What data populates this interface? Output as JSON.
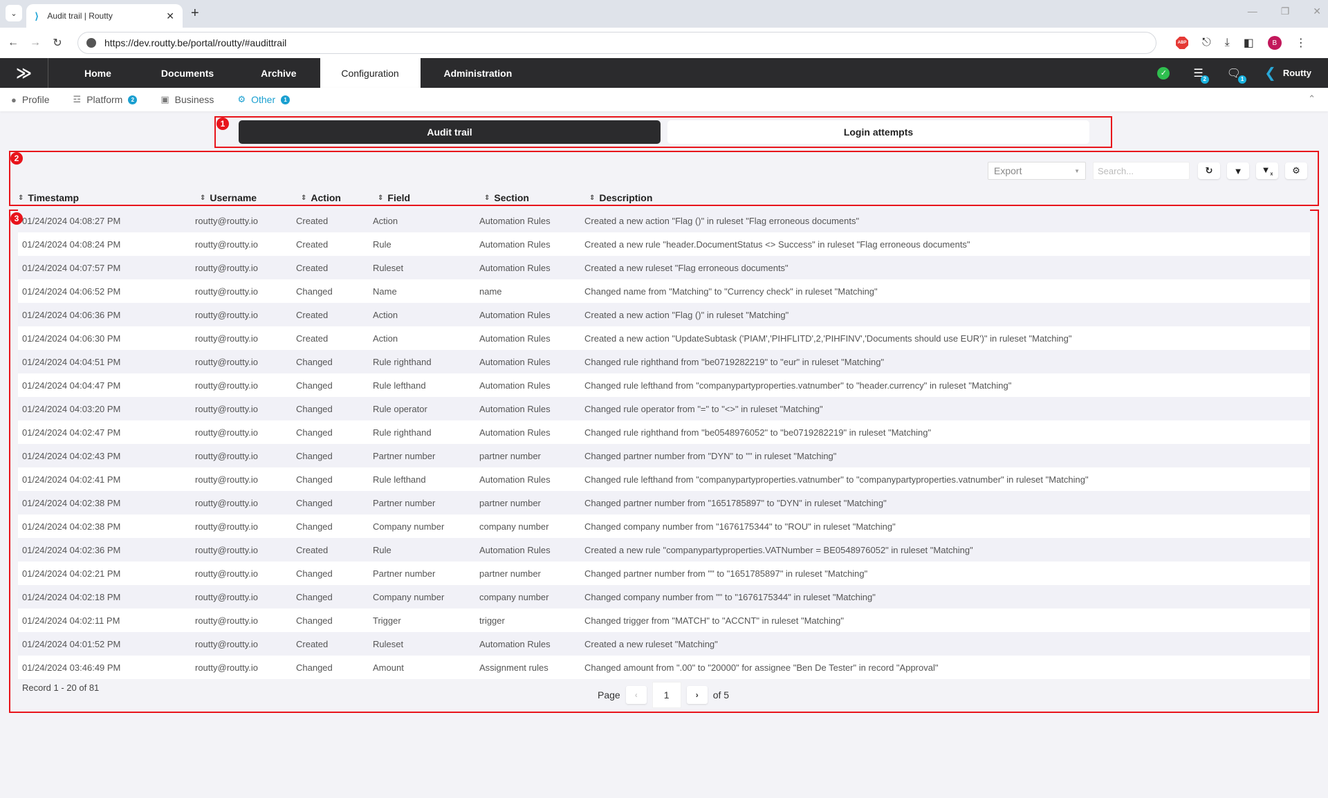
{
  "browser": {
    "tab_title": "Audit trail | Routty",
    "url": "https://dev.routty.be/portal/routty/#audittrail",
    "profile_initial": "B"
  },
  "nav": {
    "items": [
      {
        "label": "Home"
      },
      {
        "label": "Documents"
      },
      {
        "label": "Archive"
      },
      {
        "label": "Configuration"
      },
      {
        "label": "Administration"
      }
    ],
    "tasks_count": "2",
    "messages_count": "1",
    "brand": "Routty"
  },
  "subnav": {
    "items": [
      {
        "label": "Profile",
        "count": null
      },
      {
        "label": "Platform",
        "count": "2"
      },
      {
        "label": "Business",
        "count": null
      },
      {
        "label": "Other",
        "count": "1"
      }
    ]
  },
  "annotations": [
    "1",
    "2",
    "3"
  ],
  "segments": {
    "audit": "Audit trail",
    "login": "Login attempts"
  },
  "toolbar": {
    "export_label": "Export",
    "search_placeholder": "Search..."
  },
  "table": {
    "columns": [
      "Timestamp",
      "Username",
      "Action",
      "Field",
      "Section",
      "Description"
    ],
    "rows": [
      [
        "01/24/2024 04:08:27 PM",
        "routty@routty.io",
        "Created",
        "Action",
        "Automation Rules",
        "Created a new action \"Flag ()\" in ruleset \"Flag erroneous documents\""
      ],
      [
        "01/24/2024 04:08:24 PM",
        "routty@routty.io",
        "Created",
        "Rule",
        "Automation Rules",
        "Created a new rule \"header.DocumentStatus <> Success\" in ruleset \"Flag erroneous documents\""
      ],
      [
        "01/24/2024 04:07:57 PM",
        "routty@routty.io",
        "Created",
        "Ruleset",
        "Automation Rules",
        "Created a new ruleset \"Flag erroneous documents\""
      ],
      [
        "01/24/2024 04:06:52 PM",
        "routty@routty.io",
        "Changed",
        "Name",
        "name",
        "Changed name from \"Matching\" to \"Currency check\" in ruleset \"Matching\""
      ],
      [
        "01/24/2024 04:06:36 PM",
        "routty@routty.io",
        "Created",
        "Action",
        "Automation Rules",
        "Created a new action \"Flag ()\" in ruleset \"Matching\""
      ],
      [
        "01/24/2024 04:06:30 PM",
        "routty@routty.io",
        "Created",
        "Action",
        "Automation Rules",
        "Created a new action \"UpdateSubtask ('PIAM','PIHFLITD',2,'PIHFINV','Documents should use EUR')\" in ruleset \"Matching\""
      ],
      [
        "01/24/2024 04:04:51 PM",
        "routty@routty.io",
        "Changed",
        "Rule righthand",
        "Automation Rules",
        "Changed rule righthand from \"be0719282219\" to \"eur\" in ruleset \"Matching\""
      ],
      [
        "01/24/2024 04:04:47 PM",
        "routty@routty.io",
        "Changed",
        "Rule lefthand",
        "Automation Rules",
        "Changed rule lefthand from \"companypartyproperties.vatnumber\" to \"header.currency\" in ruleset \"Matching\""
      ],
      [
        "01/24/2024 04:03:20 PM",
        "routty@routty.io",
        "Changed",
        "Rule operator",
        "Automation Rules",
        "Changed rule operator from \"=\" to \"<>\" in ruleset \"Matching\""
      ],
      [
        "01/24/2024 04:02:47 PM",
        "routty@routty.io",
        "Changed",
        "Rule righthand",
        "Automation Rules",
        "Changed rule righthand from \"be0548976052\" to \"be0719282219\" in ruleset \"Matching\""
      ],
      [
        "01/24/2024 04:02:43 PM",
        "routty@routty.io",
        "Changed",
        "Partner number",
        "partner number",
        "Changed partner number from \"DYN\" to \"\" in ruleset \"Matching\""
      ],
      [
        "01/24/2024 04:02:41 PM",
        "routty@routty.io",
        "Changed",
        "Rule lefthand",
        "Automation Rules",
        "Changed rule lefthand from \"companypartyproperties.vatnumber\" to \"companypartyproperties.vatnumber\" in ruleset \"Matching\""
      ],
      [
        "01/24/2024 04:02:38 PM",
        "routty@routty.io",
        "Changed",
        "Partner number",
        "partner number",
        "Changed partner number from \"1651785897\" to \"DYN\" in ruleset \"Matching\""
      ],
      [
        "01/24/2024 04:02:38 PM",
        "routty@routty.io",
        "Changed",
        "Company number",
        "company number",
        "Changed company number from \"1676175344\" to \"ROU\" in ruleset \"Matching\""
      ],
      [
        "01/24/2024 04:02:36 PM",
        "routty@routty.io",
        "Created",
        "Rule",
        "Automation Rules",
        "Created a new rule \"companypartyproperties.VATNumber = BE0548976052\" in ruleset \"Matching\""
      ],
      [
        "01/24/2024 04:02:21 PM",
        "routty@routty.io",
        "Changed",
        "Partner number",
        "partner number",
        "Changed partner number from \"\" to \"1651785897\" in ruleset \"Matching\""
      ],
      [
        "01/24/2024 04:02:18 PM",
        "routty@routty.io",
        "Changed",
        "Company number",
        "company number",
        "Changed company number from \"\" to \"1676175344\" in ruleset \"Matching\""
      ],
      [
        "01/24/2024 04:02:11 PM",
        "routty@routty.io",
        "Changed",
        "Trigger",
        "trigger",
        "Changed trigger from \"MATCH\" to \"ACCNT\" in ruleset \"Matching\""
      ],
      [
        "01/24/2024 04:01:52 PM",
        "routty@routty.io",
        "Created",
        "Ruleset",
        "Automation Rules",
        "Created a new ruleset \"Matching\""
      ],
      [
        "01/24/2024 03:46:49 PM",
        "routty@routty.io",
        "Changed",
        "Amount",
        "Assignment rules",
        "Changed amount from \".00\" to \"20000\" for assignee \"Ben De Tester\" in record \"Approval\""
      ]
    ]
  },
  "footer": {
    "record_info": "Record 1 - 20 of 81",
    "page_label": "Page",
    "current_page": "1",
    "of_pages": "of 5"
  }
}
